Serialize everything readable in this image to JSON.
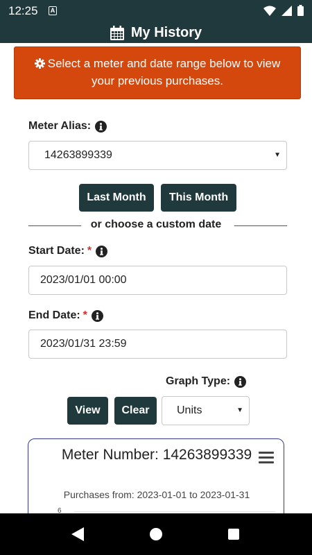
{
  "status_bar": {
    "time": "12:25",
    "notification_badge": "A"
  },
  "app_bar": {
    "title": "My History",
    "icon": "calendar-icon"
  },
  "banner": {
    "icon": "gear-icon",
    "text": "Select a meter and date range below to view your previous purchases.",
    "color": "#d4470d"
  },
  "meter": {
    "label": "Meter Alias:",
    "selected": "14263899339"
  },
  "quick_range": {
    "last_month": "Last Month",
    "this_month": "This Month"
  },
  "divider": {
    "text": "or choose a custom date"
  },
  "start_date": {
    "label": "Start Date:",
    "required_mark": "*",
    "value": "2023/01/01 00:00"
  },
  "end_date": {
    "label": "End Date:",
    "required_mark": "*",
    "value": "2023/01/31 23:59"
  },
  "graph_type": {
    "label": "Graph Type:",
    "selected": "Units"
  },
  "actions": {
    "view": "View",
    "clear": "Clear"
  },
  "chart": {
    "title": "Meter Number: 14263899339",
    "subtitle": "Purchases from: 2023-01-01 to 2023-01-31",
    "menu_icon": "hamburger-menu-icon"
  },
  "chart_data": {
    "type": "bar",
    "title": "Meter Number: 14263899339",
    "subtitle": "Purchases from: 2023-01-01 to 2023-01-31",
    "y_ticks": [
      "6"
    ]
  },
  "theme": {
    "primary": "#1f393d",
    "accent": "#d4470d",
    "required": "#d32f2f"
  }
}
